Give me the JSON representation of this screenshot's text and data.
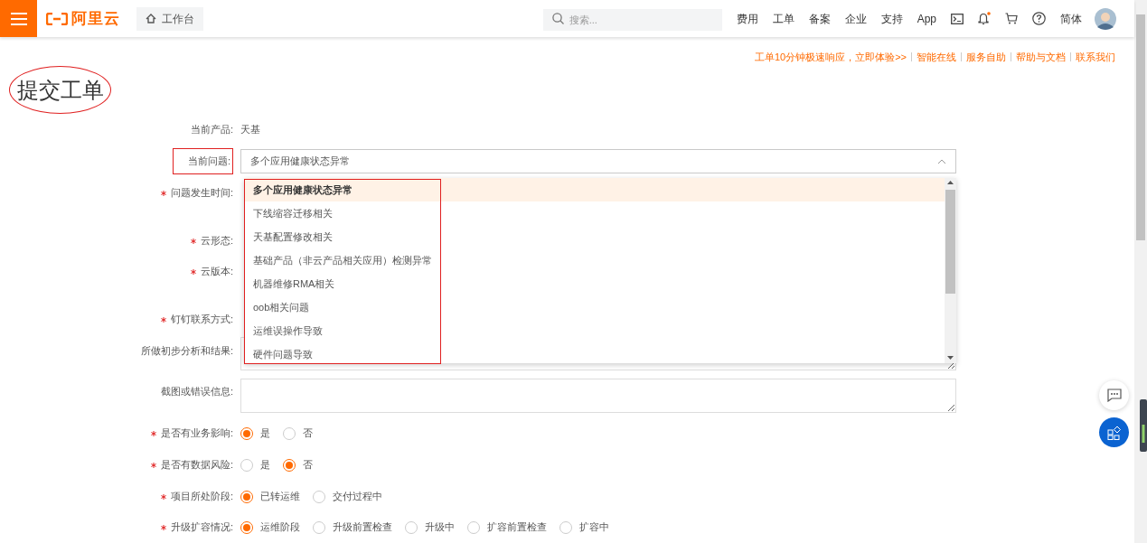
{
  "header": {
    "logo": "阿里云",
    "workbench": "工作台",
    "search": {
      "placeholder": "搜索..."
    },
    "nav": [
      "费用",
      "工单",
      "备案",
      "企业",
      "支持",
      "App"
    ],
    "notification_dot": true,
    "language": "简体"
  },
  "top_links": [
    "工单10分钟极速响应，立即体验>>",
    "智能在线",
    "服务自助",
    "帮助与文档",
    "联系我们"
  ],
  "title": "提交工单",
  "form": [
    {
      "kind": "text",
      "label": "当前产品:",
      "required": false,
      "value": "天基"
    },
    {
      "kind": "select",
      "label": "当前问题:",
      "required": false,
      "value": "多个应用健康状态异常",
      "expanded": true,
      "highlighted": true
    },
    {
      "kind": "covered",
      "label": "问题发生时间:",
      "required": true
    },
    {
      "kind": "covered",
      "label": "云形态:",
      "required": true
    },
    {
      "kind": "covered",
      "label": "云版本:",
      "required": true
    },
    {
      "kind": "covered",
      "label": "钉钉联系方式:",
      "required": true
    },
    {
      "kind": "textarea",
      "label": "所做初步分析和结果:",
      "required": false
    },
    {
      "kind": "textarea",
      "label": "截图或错误信息:",
      "required": false
    },
    {
      "kind": "radio",
      "label": "是否有业务影响:",
      "required": true,
      "options": [
        {
          "label": "是",
          "selected": true
        },
        {
          "label": "否",
          "selected": false
        }
      ]
    },
    {
      "kind": "radio",
      "label": "是否有数据风险:",
      "required": true,
      "options": [
        {
          "label": "是",
          "selected": false
        },
        {
          "label": "否",
          "selected": true
        }
      ]
    },
    {
      "kind": "radio",
      "label": "项目所处阶段:",
      "required": true,
      "options": [
        {
          "label": "已转运维",
          "selected": true
        },
        {
          "label": "交付过程中",
          "selected": false
        }
      ]
    },
    {
      "kind": "radio",
      "label": "升级扩容情况:",
      "required": true,
      "options": [
        {
          "label": "运维阶段",
          "selected": true
        },
        {
          "label": "升级前置检查",
          "selected": false
        },
        {
          "label": "升级中",
          "selected": false
        },
        {
          "label": "扩容前置检查",
          "selected": false
        },
        {
          "label": "扩容中",
          "selected": false
        }
      ]
    }
  ],
  "dropdown": [
    {
      "label": "多个应用健康状态异常",
      "selected": true
    },
    {
      "label": "下线缩容迁移相关",
      "selected": false
    },
    {
      "label": "天基配置修改相关",
      "selected": false
    },
    {
      "label": "基础产品（非云产品相关应用）检测异常",
      "selected": false
    },
    {
      "label": "机器维修RMA相关",
      "selected": false
    },
    {
      "label": "oob相关问题",
      "selected": false
    },
    {
      "label": "运维误操作导致",
      "selected": false
    },
    {
      "label": "硬件问题导致",
      "selected": false
    }
  ]
}
